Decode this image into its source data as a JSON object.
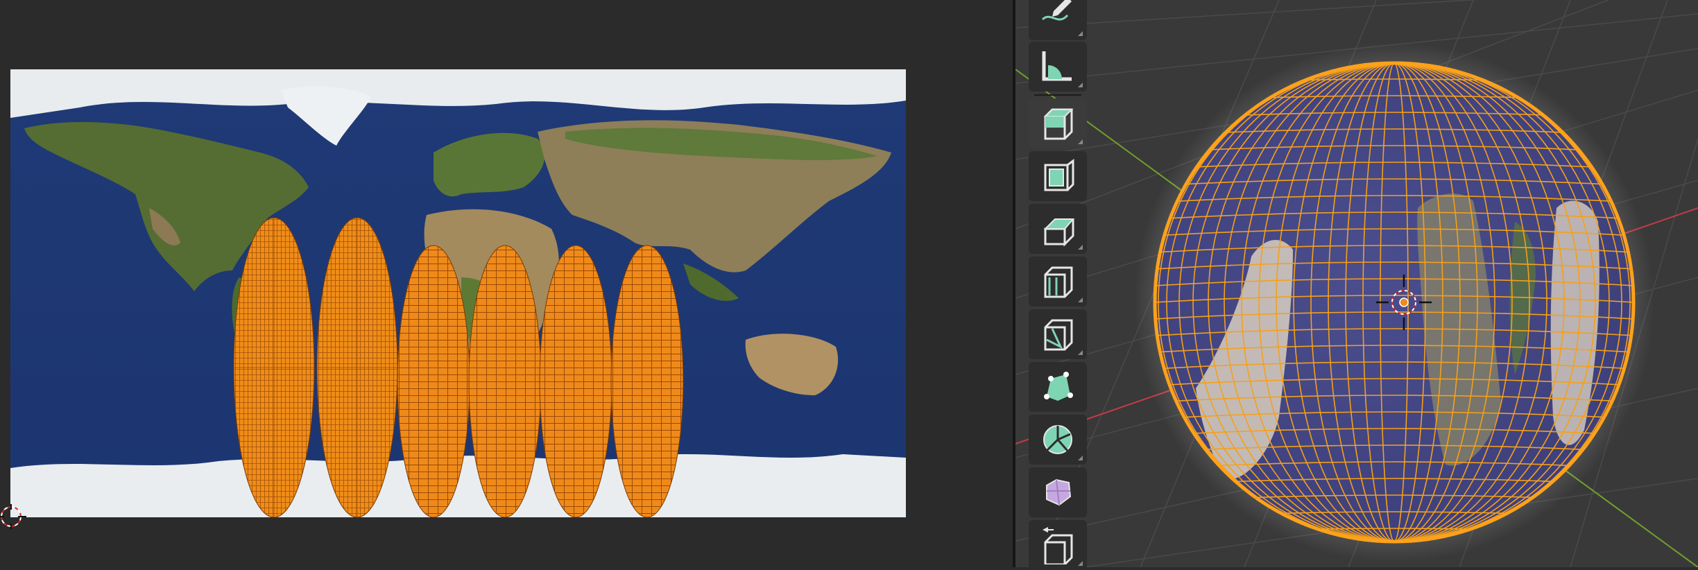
{
  "uv_editor": {
    "image_texture": "world-map",
    "uv_island_color": "#f18a14"
  },
  "viewport": {
    "object": "uv-sphere",
    "wire_color": "#ffa21a",
    "axis_x_color": "#c63a4a",
    "axis_y_color": "#73a12b",
    "background": "#3a3a3a"
  },
  "toolbar": {
    "tools": [
      {
        "name": "annotate-tool",
        "icon": "pencil-squiggle-icon"
      },
      {
        "name": "measure-tool",
        "icon": "ruler-angle-icon"
      },
      {
        "name": "add-cube-tool",
        "icon": "cube-add-icon"
      },
      {
        "name": "extrude-region-tool",
        "icon": "extrude-icon"
      },
      {
        "name": "inset-faces-tool",
        "icon": "inset-icon"
      },
      {
        "name": "bevel-tool",
        "icon": "bevel-icon"
      },
      {
        "name": "loop-cut-tool",
        "icon": "loop-cut-icon"
      },
      {
        "name": "knife-tool",
        "icon": "knife-icon"
      },
      {
        "name": "poly-build-tool",
        "icon": "poly-build-icon"
      },
      {
        "name": "spin-tool",
        "icon": "spin-icon"
      },
      {
        "name": "smooth-tool",
        "icon": "smooth-vertices-icon"
      },
      {
        "name": "edge-slide-tool",
        "icon": "edge-slide-icon"
      }
    ]
  }
}
